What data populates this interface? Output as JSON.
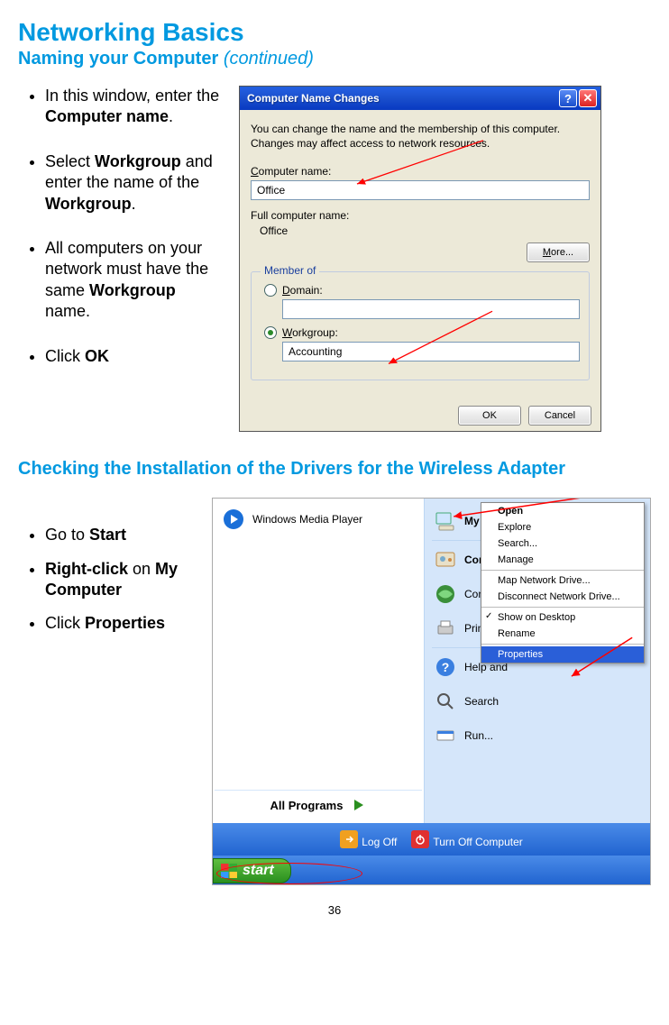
{
  "title": "Networking Basics",
  "subtitle_main": "Naming your Computer",
  "subtitle_cont": "(continued)",
  "instructions1": [
    {
      "pre": "In this window, enter the ",
      "bold": "Computer name",
      "post": "."
    },
    {
      "pre": "Select ",
      "bold": "Workgroup",
      "mid": " and enter the name of the ",
      "bold2": "Workgroup",
      "post": "."
    },
    {
      "pre": "All computers on your network must have the same ",
      "bold": "Workgroup",
      "post": " name."
    },
    {
      "pre": " Click ",
      "bold": "OK",
      "post": ""
    }
  ],
  "dialog1": {
    "titlebar": "Computer Name Changes",
    "info": "You can change the name and the membership of this computer. Changes may affect access to network resources.",
    "label_computer_name": "Computer name:",
    "value_computer_name": "Office",
    "label_full_name": "Full computer name:",
    "value_full_name": "Office",
    "btn_more": "More...",
    "groupbox_title": "Member of",
    "radio_domain_label": "Domain:",
    "radio_domain_value": "",
    "radio_workgroup_label": "Workgroup:",
    "radio_workgroup_value": "Accounting",
    "btn_ok": "OK",
    "btn_cancel": "Cancel"
  },
  "section2_title": "Checking the Installation of the Drivers for the Wireless Adapter",
  "instructions2": [
    {
      "pre": "Go to ",
      "bold": "Start",
      "post": ""
    },
    {
      "bold": "Right-click",
      "mid": " on ",
      "bold2": "My Computer"
    },
    {
      "pre": "Click ",
      "bold": "Properties",
      "post": ""
    }
  ],
  "startmenu": {
    "left_wmp": "Windows Media Player",
    "all_programs": "All Programs",
    "right_items": [
      "My Com",
      "Control P",
      "Connect",
      "Printers a",
      "Help and",
      "Search",
      "Run..."
    ],
    "ctx_items": [
      "Open",
      "Explore",
      "Search...",
      "Manage",
      "Map Network Drive...",
      "Disconnect Network Drive...",
      "Show on Desktop",
      "Rename",
      "Properties"
    ],
    "logoff": "Log Off",
    "turnoff": "Turn Off Computer",
    "start": "start"
  },
  "page_number": "36"
}
